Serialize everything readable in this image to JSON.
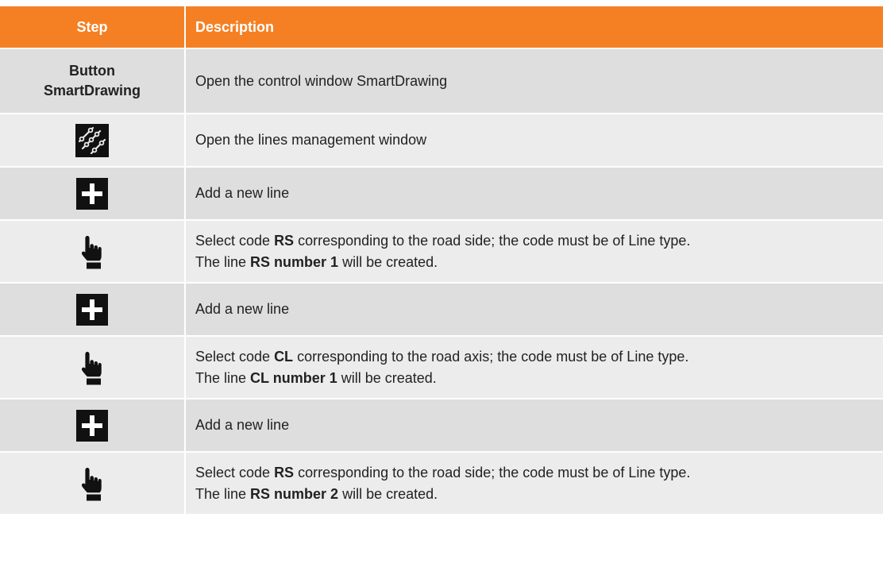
{
  "table": {
    "headers": {
      "step": "Step",
      "description": "Description"
    },
    "rows": [
      {
        "step_text": "Button SmartDrawing",
        "step_icon": null,
        "description": [
          {
            "t": "Open the control window SmartDrawing",
            "b": false
          }
        ]
      },
      {
        "step_text": null,
        "step_icon": "lines-management-icon",
        "description": [
          {
            "t": "Open the lines management window",
            "b": false
          }
        ]
      },
      {
        "step_text": null,
        "step_icon": "plus-icon",
        "description": [
          {
            "t": "Add a new line",
            "b": false
          }
        ]
      },
      {
        "step_text": null,
        "step_icon": "hand-pointer-icon",
        "description": [
          {
            "t": "Select code ",
            "b": false
          },
          {
            "t": "RS",
            "b": true
          },
          {
            "t": " corresponding to the road side; the code must be of Line type.",
            "b": false
          },
          {
            "t": "\n",
            "b": false
          },
          {
            "t": "The line ",
            "b": false
          },
          {
            "t": "RS number 1",
            "b": true
          },
          {
            "t": " will be created.",
            "b": false
          }
        ]
      },
      {
        "step_text": null,
        "step_icon": "plus-icon",
        "description": [
          {
            "t": "Add a new line",
            "b": false
          }
        ]
      },
      {
        "step_text": null,
        "step_icon": "hand-pointer-icon",
        "description": [
          {
            "t": "Select code ",
            "b": false
          },
          {
            "t": "CL",
            "b": true
          },
          {
            "t": " corresponding to the road axis; the code must be of Line type.",
            "b": false
          },
          {
            "t": "\n",
            "b": false
          },
          {
            "t": "The line ",
            "b": false
          },
          {
            "t": "CL number 1",
            "b": true
          },
          {
            "t": " will be created.",
            "b": false
          }
        ]
      },
      {
        "step_text": null,
        "step_icon": "plus-icon",
        "description": [
          {
            "t": "Add a new line",
            "b": false
          }
        ]
      },
      {
        "step_text": null,
        "step_icon": "hand-pointer-icon",
        "description": [
          {
            "t": "Select code ",
            "b": false
          },
          {
            "t": "RS",
            "b": true
          },
          {
            "t": " corresponding to the road side; the code must be of Line type.",
            "b": false
          },
          {
            "t": "\n",
            "b": false
          },
          {
            "t": "The line ",
            "b": false
          },
          {
            "t": "RS number 2",
            "b": true
          },
          {
            "t": " will be created.",
            "b": false
          }
        ]
      }
    ]
  },
  "colors": {
    "header_bg": "#f58024",
    "header_text": "#ffffff",
    "row_odd_bg": "#dedede",
    "row_even_bg": "#ececec",
    "icon_bg": "#111111"
  }
}
